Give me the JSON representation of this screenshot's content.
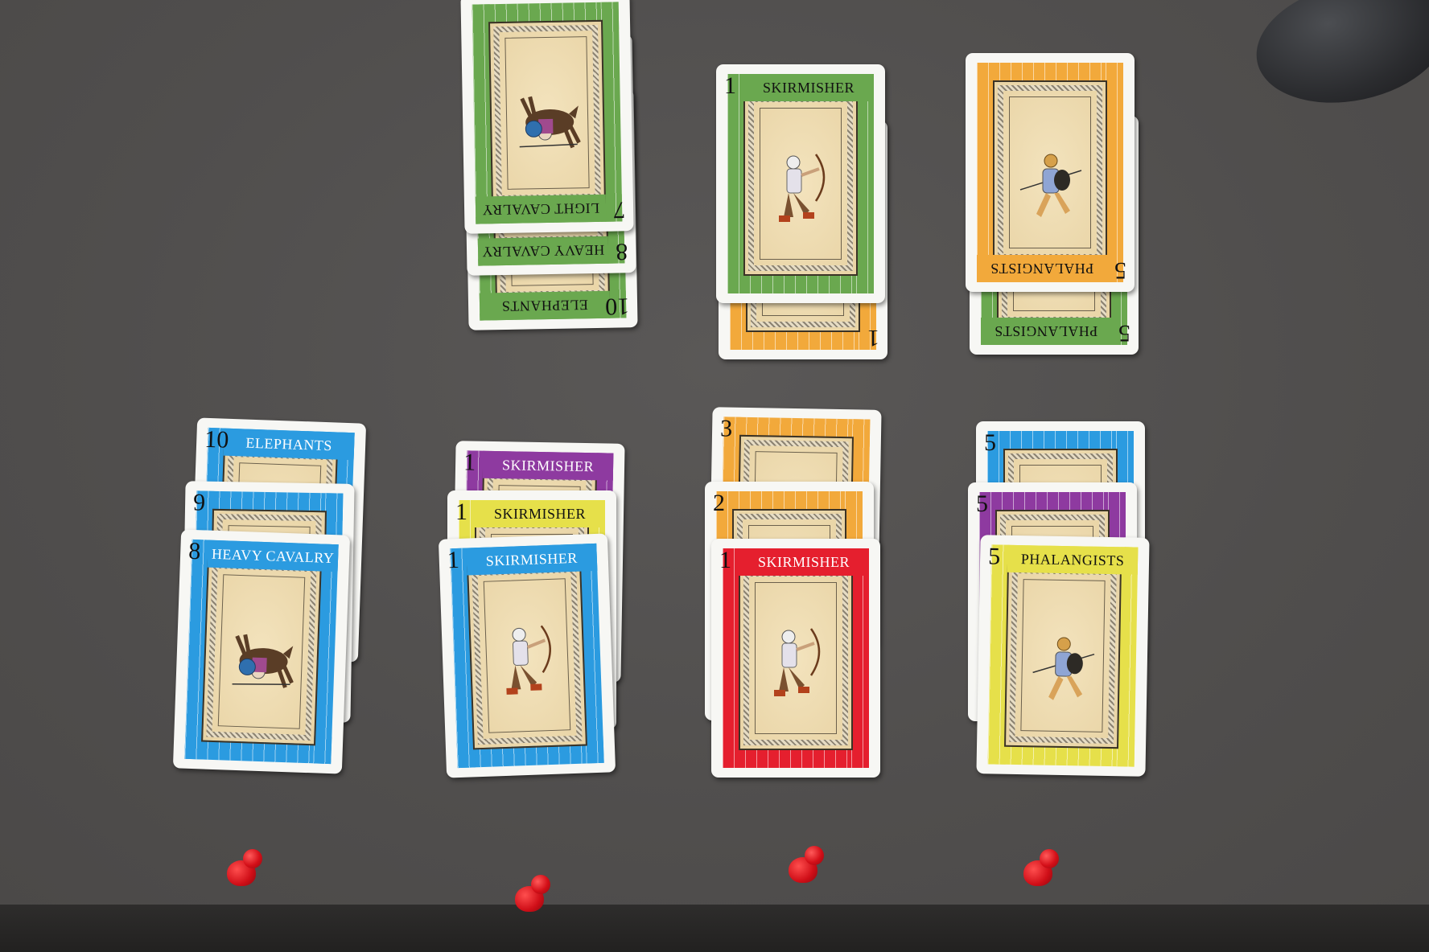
{
  "colors": {
    "green": "#6aa84f",
    "orange": "#f2a93b",
    "blue": "#2b9be0",
    "purple": "#8e3aa0",
    "yellow": "#e6e04a",
    "red": "#e51f2e"
  },
  "stacks": [
    {
      "name": "top-left-stack",
      "cards": [
        {
          "rank": "10",
          "title": "ELEPHANTS",
          "color": "green",
          "flipped": true
        },
        {
          "rank": "8",
          "title": "HEAVY CAVALRY",
          "color": "green",
          "flipped": true
        },
        {
          "rank": "7",
          "title": "LIGHT CAVALRY",
          "color": "green",
          "flipped": true,
          "figure": "horse"
        }
      ]
    },
    {
      "name": "top-middle-stack",
      "cards": [
        {
          "rank": "1",
          "title": "",
          "color": "orange",
          "flipped": true
        },
        {
          "rank": "1",
          "title": "SKIRMISHER",
          "color": "green",
          "figure": "archer"
        }
      ]
    },
    {
      "name": "top-right-stack",
      "cards": [
        {
          "rank": "5",
          "title": "PHALANGISTS",
          "color": "green",
          "flipped": true
        },
        {
          "rank": "5",
          "title": "PHALANGISTS",
          "color": "orange",
          "flipped": true,
          "figure": "spear"
        }
      ]
    },
    {
      "name": "bottom-stack-1",
      "cards": [
        {
          "rank": "10",
          "title": "ELEPHANTS",
          "color": "blue"
        },
        {
          "rank": "9",
          "title": "",
          "color": "blue"
        },
        {
          "rank": "8",
          "title": "HEAVY CAVALRY",
          "color": "blue",
          "figure": "horse"
        }
      ]
    },
    {
      "name": "bottom-stack-2",
      "cards": [
        {
          "rank": "1",
          "title": "SKIRMISHER",
          "color": "purple"
        },
        {
          "rank": "1",
          "title": "SKIRMISHER",
          "color": "yellow"
        },
        {
          "rank": "1",
          "title": "SKIRMISHER",
          "color": "blue",
          "figure": "archer"
        }
      ]
    },
    {
      "name": "bottom-stack-3",
      "cards": [
        {
          "rank": "3",
          "title": "",
          "color": "orange"
        },
        {
          "rank": "2",
          "title": "",
          "color": "orange"
        },
        {
          "rank": "1",
          "title": "SKIRMISHER",
          "color": "red",
          "figure": "archer"
        }
      ]
    },
    {
      "name": "bottom-stack-4",
      "cards": [
        {
          "rank": "5",
          "title": "",
          "color": "blue"
        },
        {
          "rank": "5",
          "title": "",
          "color": "purple"
        },
        {
          "rank": "5",
          "title": "PHALANGISTS",
          "color": "yellow",
          "figure": "spear"
        }
      ]
    }
  ],
  "pawns": [
    {
      "color": "red"
    },
    {
      "color": "red"
    },
    {
      "color": "red"
    },
    {
      "color": "red"
    }
  ]
}
